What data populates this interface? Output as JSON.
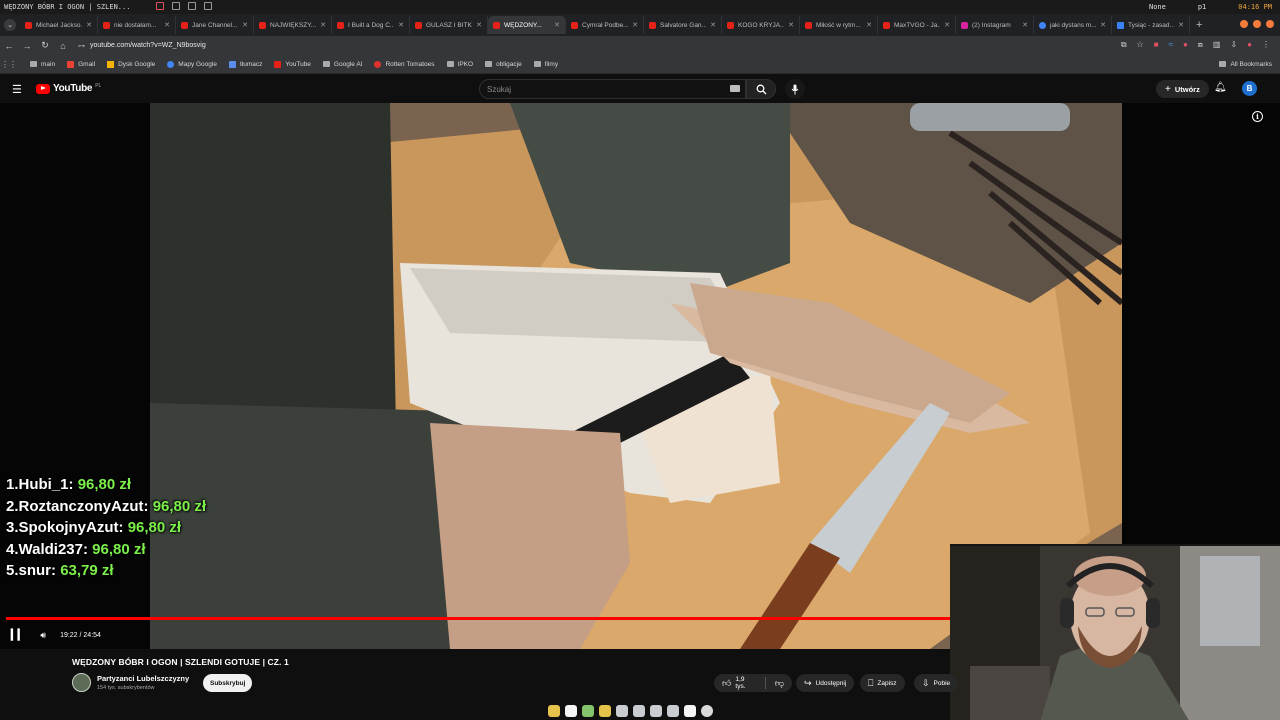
{
  "system_bar": {
    "window_title": "WĘDZONY BÓBR I OGON | SZLEN...",
    "user_label": "None",
    "profile_label": "p1",
    "clock": "04:16 PM"
  },
  "tabs": [
    {
      "label": "Michael Jackso...",
      "icon": "youtube-icon",
      "active": false
    },
    {
      "label": "nie dostałam...",
      "icon": "youtube-icon",
      "active": false
    },
    {
      "label": "Jane Channel...",
      "icon": "youtube-icon",
      "active": false
    },
    {
      "label": "NAJWIĘKSZY...",
      "icon": "youtube-icon",
      "active": false
    },
    {
      "label": "I Built a Dog C...",
      "icon": "youtube-icon",
      "active": false
    },
    {
      "label": "GULASZ I BITK...",
      "icon": "youtube-icon",
      "active": false
    },
    {
      "label": "WĘDZONY...",
      "icon": "youtube-icon",
      "active": true
    },
    {
      "label": "Cymrał Podbe...",
      "icon": "youtube-icon",
      "active": false
    },
    {
      "label": "Salvatore Gan...",
      "icon": "youtube-icon",
      "active": false
    },
    {
      "label": "KOGO KRYJA...",
      "icon": "youtube-icon",
      "active": false
    },
    {
      "label": "Miłość w rytm...",
      "icon": "youtube-icon",
      "active": false
    },
    {
      "label": "MaxTVGO - Ja...",
      "icon": "youtube-icon",
      "active": false
    },
    {
      "label": "(2) Instagram",
      "icon": "instagram-icon",
      "active": false
    },
    {
      "label": "jaki dystans m...",
      "icon": "google-icon",
      "active": false
    },
    {
      "label": "Tysiąc - zasad...",
      "icon": "star-icon",
      "active": false
    }
  ],
  "navigation": {
    "url": "youtube.com/watch?v=WZ_N9bosvig"
  },
  "bookmarks": [
    {
      "label": "main",
      "icon": "folder-icon"
    },
    {
      "label": "Gmail",
      "icon": "gmail-icon"
    },
    {
      "label": "Dysk Google",
      "icon": "drive-icon"
    },
    {
      "label": "Mapy Google",
      "icon": "maps-icon"
    },
    {
      "label": "tłumacz",
      "icon": "translate-icon"
    },
    {
      "label": "YouTube",
      "icon": "youtube-icon"
    },
    {
      "label": "Google AI",
      "icon": "folder-icon"
    },
    {
      "label": "Rotten Tomatoes",
      "icon": "tomato-icon"
    },
    {
      "label": "IPKO",
      "icon": "folder-icon"
    },
    {
      "label": "obligacje",
      "icon": "folder-icon"
    },
    {
      "label": "filmy",
      "icon": "folder-icon"
    }
  ],
  "all_bookmarks_label": "All Bookmarks",
  "youtube": {
    "logo_text": "YouTube",
    "country_code": "PL",
    "search_placeholder": "Szukaj",
    "create_label": "Utwórz",
    "avatar_letter": "B"
  },
  "overlay_leaderboard": [
    {
      "rank": "1.",
      "name": "Hubi_1:",
      "amount": "96,80 zł"
    },
    {
      "rank": "2.",
      "name": "RoztanczonyAzut:",
      "amount": "96,80 zł"
    },
    {
      "rank": "3.",
      "name": "SpokojnyAzut:",
      "amount": "96,80 zł"
    },
    {
      "rank": "4.",
      "name": "Waldi237:",
      "amount": "96,80 zł"
    },
    {
      "rank": "5.",
      "name": "snur:",
      "amount": "63,79 zł"
    }
  ],
  "player": {
    "time": "19:22 / 24:54",
    "progress_fraction": 0.7778
  },
  "video": {
    "title": "WĘDZONY BÓBR I OGON | SZLENDI GOTUJE | CZ. 1",
    "channel": "Partyzanci Lubelszczyzny",
    "subscribers": "154 tys. subskrybentów",
    "subscribe_label": "Subskrybuj",
    "likes": "1,9 tys.",
    "share_label": "Udostępnij",
    "save_label": "Zapisz",
    "download_label": "Pobie"
  },
  "colors": {
    "youtube_red": "#ff0000",
    "leaderboard_amount": "#7cf04a",
    "background": "#0f0f0f"
  }
}
